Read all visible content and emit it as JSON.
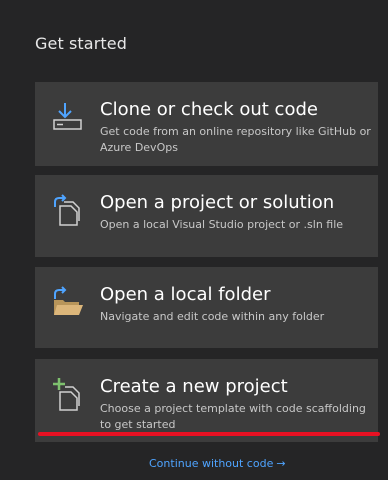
{
  "heading": "Get started",
  "cards": [
    {
      "title": "Clone or check out code",
      "description": "Get code from an online repository like GitHub or Azure DevOps",
      "icon": "download-drive-icon"
    },
    {
      "title": "Open a project or solution",
      "description": "Open a local Visual Studio project or .sln file",
      "icon": "open-project-icon"
    },
    {
      "title": "Open a local folder",
      "description": "Navigate and edit code within any folder",
      "icon": "open-folder-icon"
    },
    {
      "title": "Create a new project",
      "description": "Choose a project template with code scaffolding to get started",
      "icon": "new-project-icon"
    }
  ],
  "continue_link": "Continue without code",
  "continue_arrow": "→",
  "colors": {
    "background": "#252526",
    "card": "#3c3c3c",
    "link": "#4fa4ff",
    "underline": "#e81123",
    "folder": "#dcb67a",
    "add": "#7ec16e"
  }
}
